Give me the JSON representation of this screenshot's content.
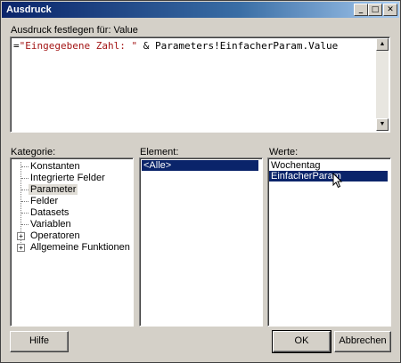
{
  "window": {
    "title": "Ausdruck"
  },
  "titlebar_buttons": {
    "minimize": "_",
    "maximize": "□",
    "close": "✕"
  },
  "expression": {
    "label": "Ausdruck festlegen für: Value",
    "prefix": "=",
    "string_literal": "\"Eingegebene Zahl: \"",
    "rest": " & Parameters!EinfacherParam.Value"
  },
  "category": {
    "label": "Kategorie:",
    "items": [
      {
        "label": "Konstanten",
        "expandable": false,
        "selected": false
      },
      {
        "label": "Integrierte Felder",
        "expandable": false,
        "selected": false
      },
      {
        "label": "Parameter",
        "expandable": false,
        "selected": true
      },
      {
        "label": "Felder",
        "expandable": false,
        "selected": false
      },
      {
        "label": "Datasets",
        "expandable": false,
        "selected": false
      },
      {
        "label": "Variablen",
        "expandable": false,
        "selected": false
      },
      {
        "label": "Operatoren",
        "expandable": true,
        "selected": false
      },
      {
        "label": "Allgemeine Funktionen",
        "expandable": true,
        "selected": false
      }
    ]
  },
  "element": {
    "label": "Element:",
    "items": [
      "<Alle>"
    ]
  },
  "values": {
    "label": "Werte:",
    "items": [
      "Wochentag",
      "EinfacherParam"
    ]
  },
  "buttons": {
    "help": "Hilfe",
    "ok": "OK",
    "cancel": "Abbrechen"
  },
  "colors": {
    "title_start": "#0a246a",
    "title_end": "#a6caf0",
    "selection": "#0a246a",
    "string_literal": "#a31515"
  }
}
